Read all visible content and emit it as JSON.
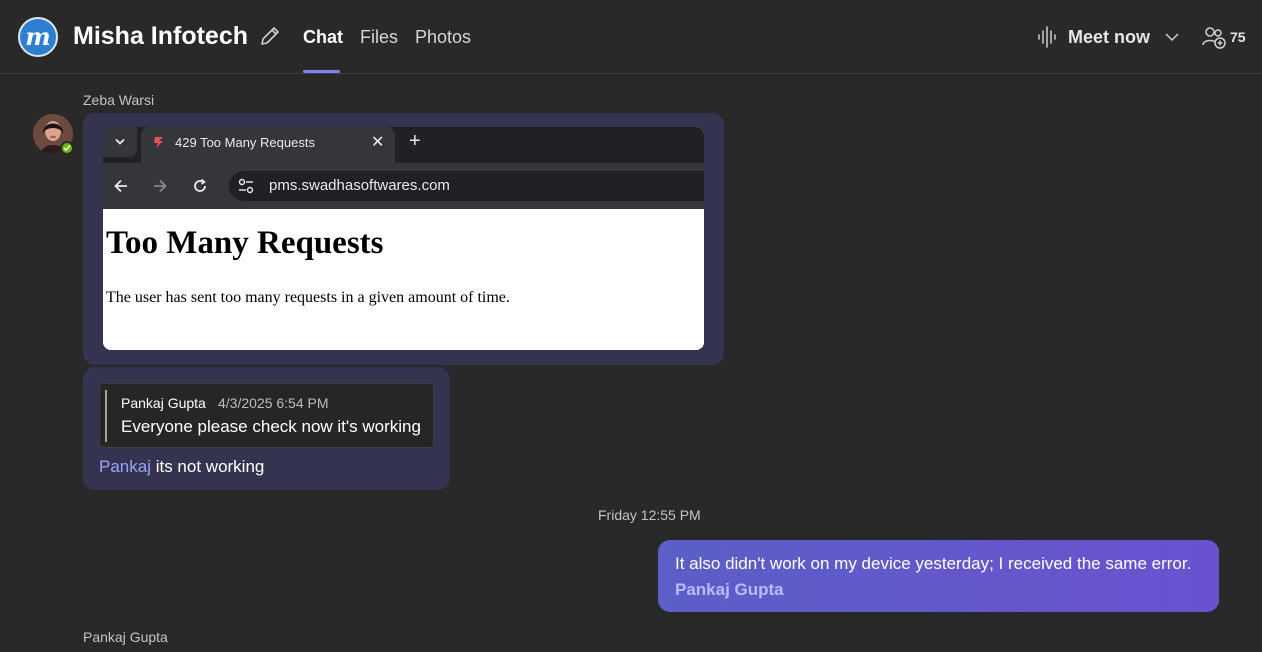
{
  "header": {
    "team_logo_letter": "m",
    "team_name": "Misha Infotech",
    "tabs": [
      {
        "label": "Chat",
        "active": true
      },
      {
        "label": "Files",
        "active": false
      },
      {
        "label": "Photos",
        "active": false
      }
    ],
    "meet_now_label": "Meet now",
    "participant_count": "75",
    "accent_color": "#7f85f5"
  },
  "messages": {
    "first": {
      "sender": "Zeba Warsi",
      "presence": "available",
      "screenshot": {
        "tab_title": "429 Too Many Requests",
        "tab_close": "✕",
        "new_tab": "+",
        "url": "pms.swadhasoftwares.com",
        "heading": "Too Many Requests",
        "body": "The user has sent too many requests in a given amount of time."
      },
      "quote": {
        "author": "Pankaj Gupta",
        "timestamp": "4/3/2025 6:54 PM",
        "text": "Everyone please check now it's working"
      },
      "reply_mention": "Pankaj",
      "reply_text": " its not working"
    },
    "date_divider": "Friday 12:55 PM",
    "mine": {
      "text": "It also didn't work on my device yesterday; I received the same error.",
      "mention": "Pankaj Gupta",
      "bubble_color": "#5b5fc7"
    },
    "next_sender": "Pankaj Gupta"
  }
}
